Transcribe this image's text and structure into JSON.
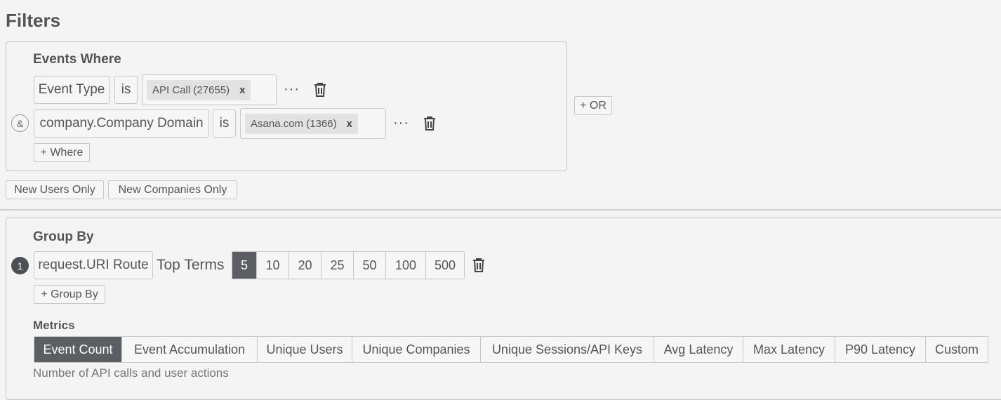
{
  "filters_title": "Filters",
  "events_where": {
    "heading": "Events Where",
    "row1": {
      "field": "Event Type",
      "op": "is",
      "chip": "API Call (27655)",
      "chip_x": "x"
    },
    "row2": {
      "joiner": "&",
      "field": "company.Company Domain",
      "op": "is",
      "chip": "Asana.com (1366)",
      "chip_x": "x"
    },
    "more_icon": "···",
    "add_where": "+ Where"
  },
  "or_button": "+ OR",
  "toggles": {
    "new_users": "New Users Only",
    "new_companies": "New Companies Only"
  },
  "group_by": {
    "heading": "Group By",
    "index": "1",
    "field": "request.URI Route",
    "top_terms_label": "Top Terms",
    "top_terms": [
      "5",
      "10",
      "20",
      "25",
      "50",
      "100",
      "500"
    ],
    "selected_top_term": "5",
    "add_group_by": "+ Group By"
  },
  "metrics": {
    "heading": "Metrics",
    "options": [
      "Event Count",
      "Event Accumulation",
      "Unique Users",
      "Unique Companies",
      "Unique Sessions/API Keys",
      "Avg Latency",
      "Max Latency",
      "P90 Latency",
      "Custom"
    ],
    "selected": "Event Count",
    "description": "Number of API calls and user actions"
  },
  "colors": {
    "active_segment": "#5b5f63",
    "border": "#c8c8c8",
    "chip_bg": "#e2e2e2"
  },
  "icons": [
    "trash-icon",
    "more-icon",
    "and-joiner-icon"
  ]
}
